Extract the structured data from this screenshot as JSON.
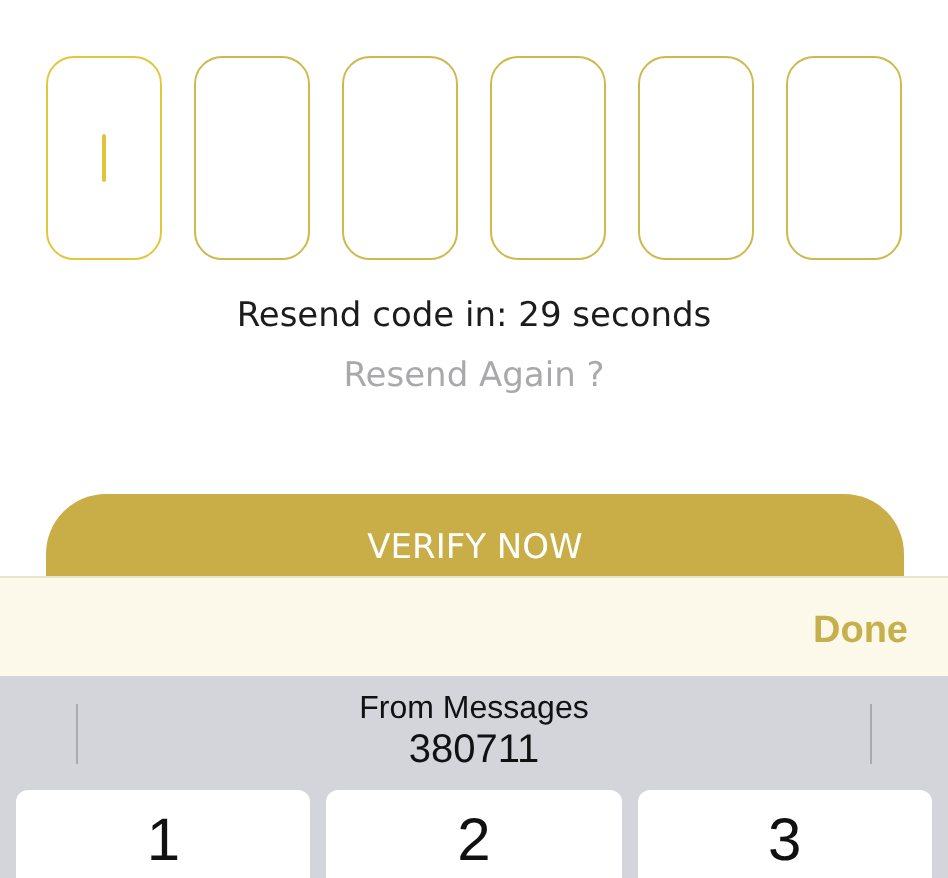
{
  "code_boxes": [
    {
      "focused": true
    },
    {
      "focused": false
    },
    {
      "focused": false
    },
    {
      "focused": false
    },
    {
      "focused": false
    },
    {
      "focused": false
    }
  ],
  "resend_timer": "Resend code in: 29 seconds",
  "resend_link": "Resend Again ?",
  "verify_button": "VERIFY NOW",
  "keyboard_toolbar": {
    "done": "Done"
  },
  "suggestion": {
    "source": "From Messages",
    "code": "380711"
  },
  "keys": [
    "1",
    "2",
    "3"
  ]
}
